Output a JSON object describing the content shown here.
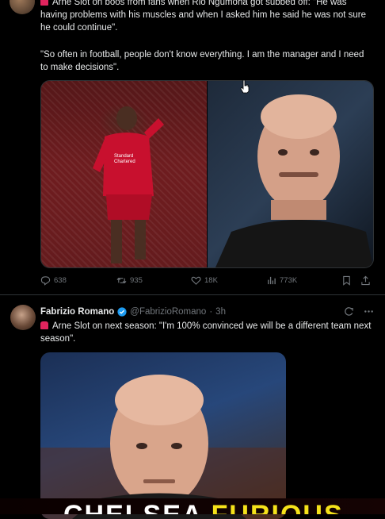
{
  "tweet1": {
    "text_line1": "Arne Slot on boos from fans when Rio Ngumoha got subbed off: \"He was having problems with his muscles and when I asked him he said he was not sure he could continue\".",
    "text_line2": "\"So often in football, people don't know everything. I am the manager and I need to make decisions\".",
    "image_left_text": "Standard Chartered",
    "actions": {
      "replies": "638",
      "reposts": "935",
      "likes": "18K",
      "views": "773K"
    }
  },
  "tweet2": {
    "author_name": "Fabrizio Romano",
    "handle": "@FabrizioRomano",
    "separator": "·",
    "time": "3h",
    "text": "Arne Slot on next season: \"I'm 100% convinced we will be a different team next season\"."
  },
  "banner": {
    "word1": "CHELSEA",
    "word2": "FURIOUS"
  },
  "colors": {
    "accent": "#1d9bf0",
    "alarm": "#e0245e",
    "banner_yellow": "#f5e21a"
  }
}
